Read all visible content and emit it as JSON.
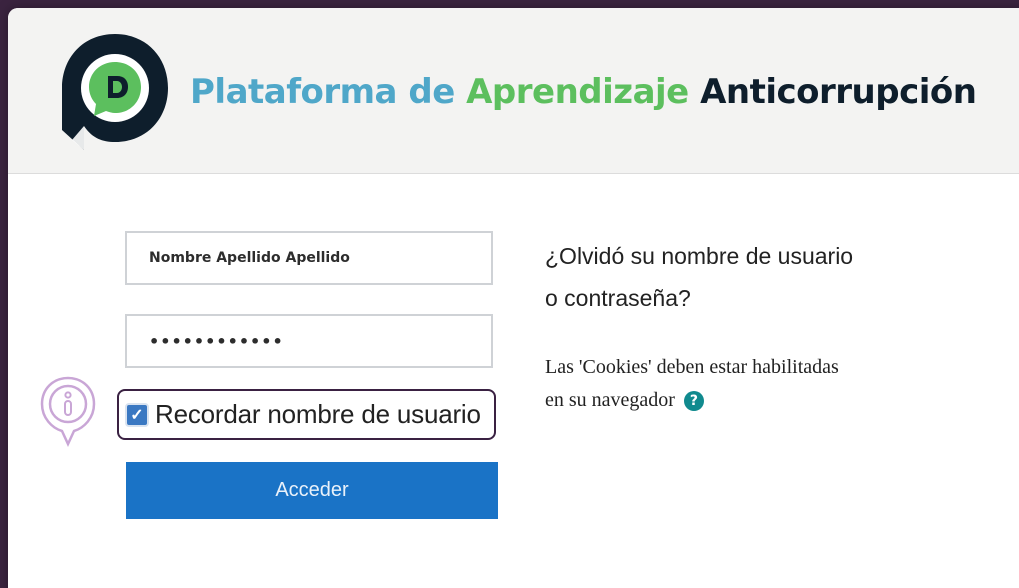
{
  "header": {
    "brand_part1": "Plataforma",
    "brand_part2": "de",
    "brand_part3": "Aprendizaje",
    "brand_part4": "Anticorrupción",
    "logo_icon": "pda-logo-icon"
  },
  "login": {
    "username_value": "Nombre Apellido Apellido",
    "password_value": "••••••••••••",
    "remember_label": "Recordar nombre de usuario",
    "remember_checked": true,
    "submit_label": "Acceder"
  },
  "side": {
    "forgot_line1": "¿Olvidó su nombre de usuario",
    "forgot_line2": "o contraseña?",
    "cookies_line1": "Las 'Cookies' deben estar habilitadas",
    "cookies_line2": "en su navegador",
    "help_icon_glyph": "?"
  },
  "overlay": {
    "info_icon": "info-pin-icon"
  },
  "colors": {
    "background": "#3b2440",
    "brand_blue": "#4fa7c9",
    "brand_green": "#5cbf5e",
    "brand_dark": "#0e1e2c",
    "button": "#1a73c6",
    "checkbox": "#3a78c2",
    "help_icon": "#108a8e"
  }
}
